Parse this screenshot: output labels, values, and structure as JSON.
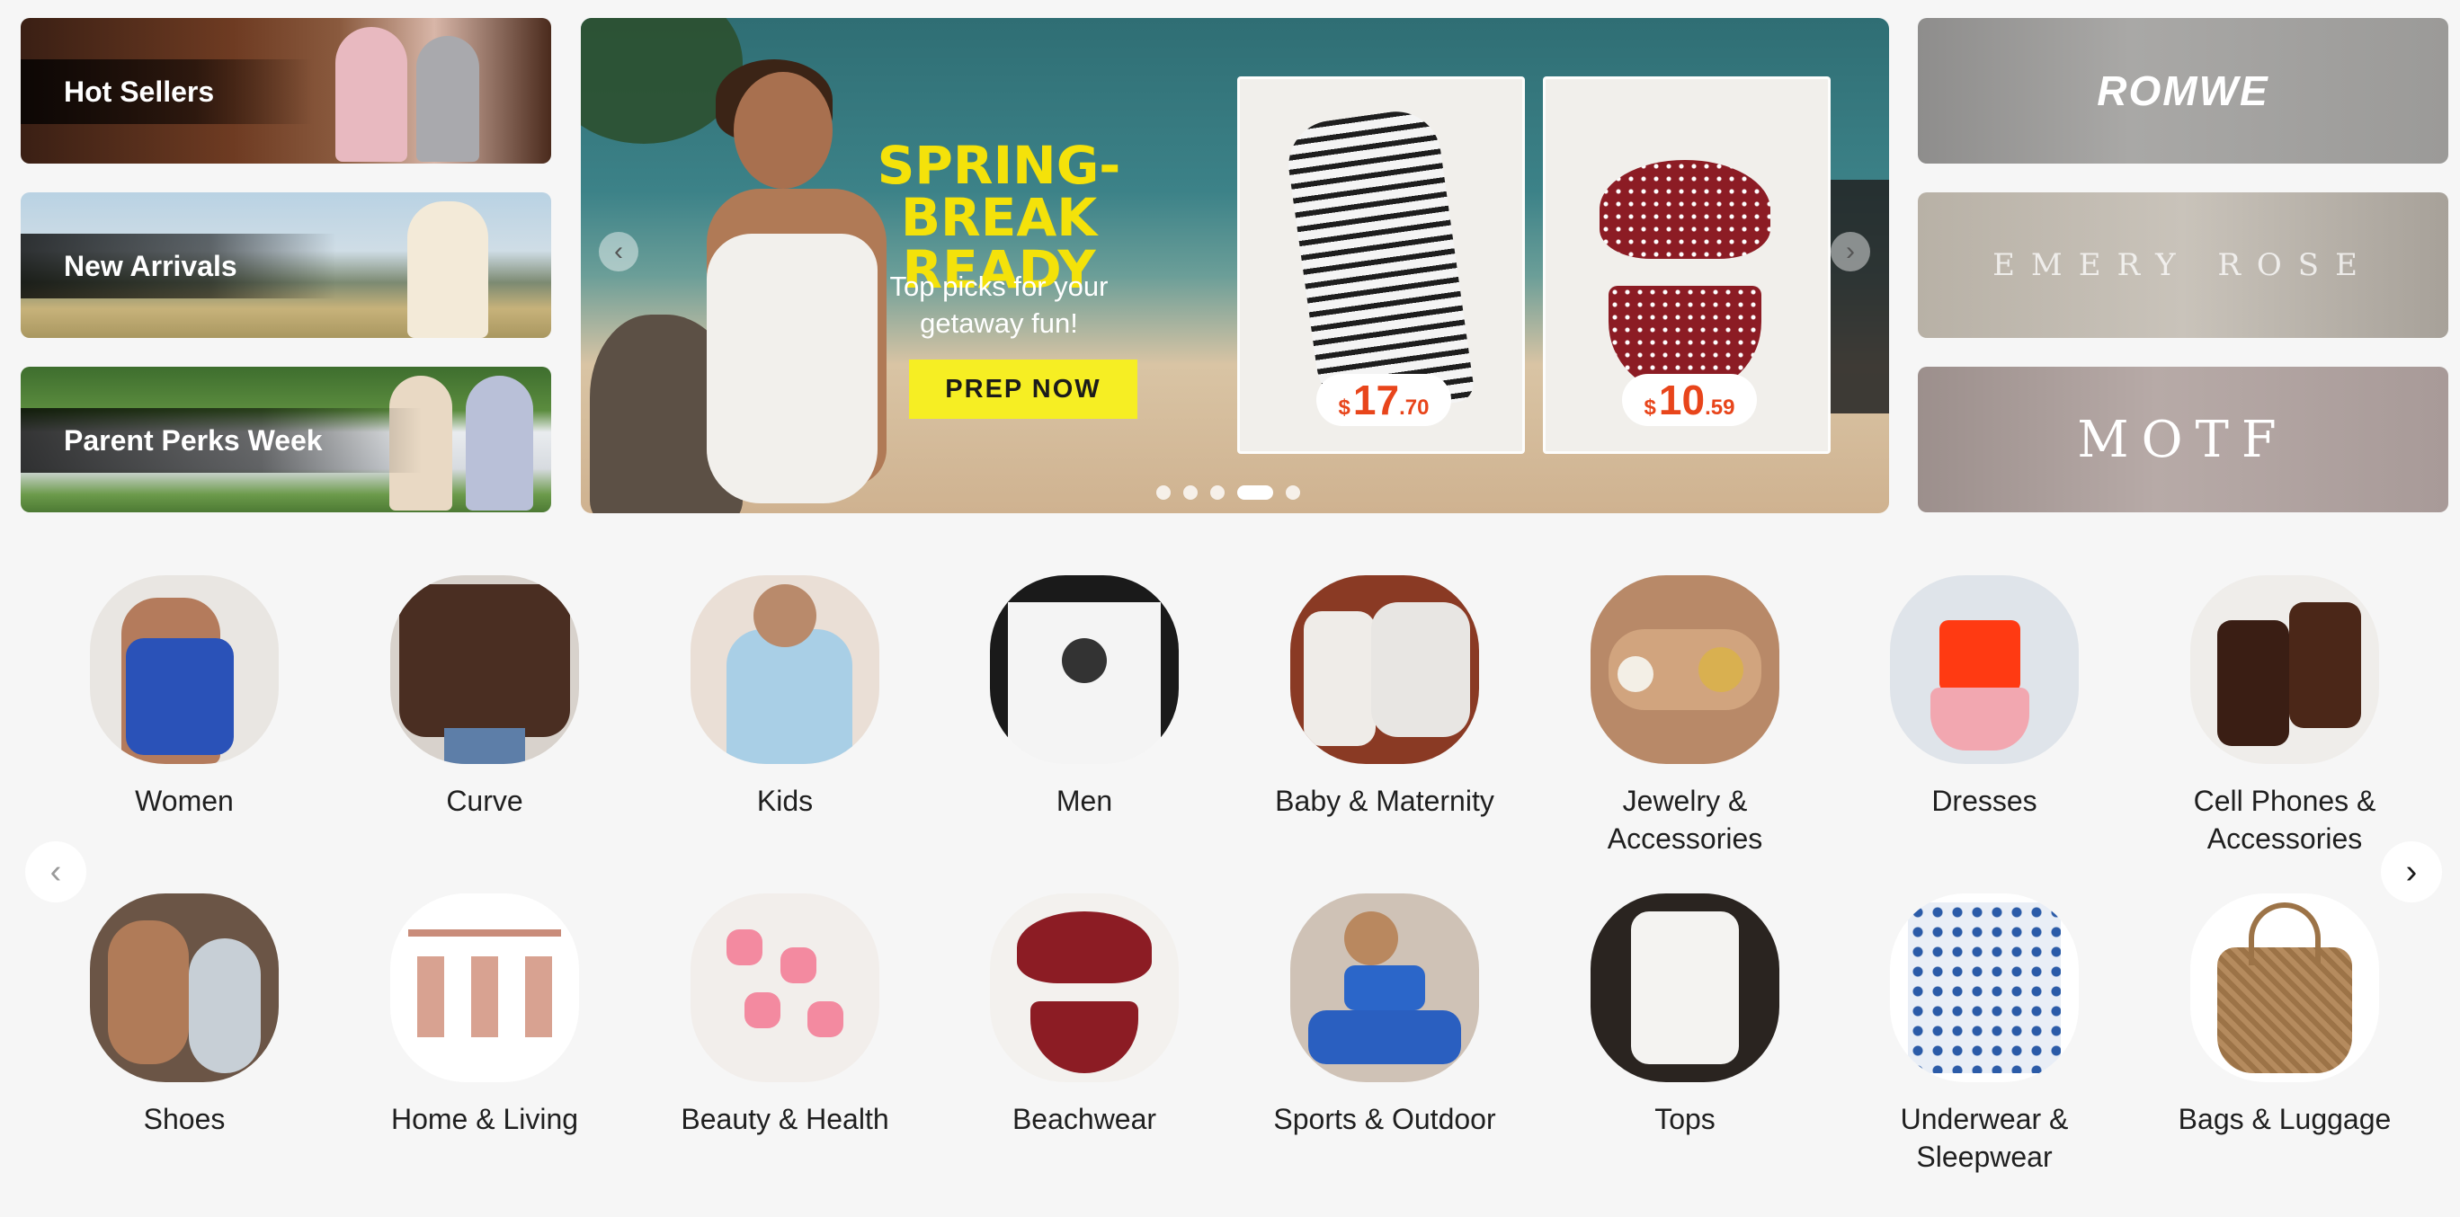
{
  "promos": [
    {
      "label": "Hot Sellers"
    },
    {
      "label": "New Arrivals"
    },
    {
      "label": "Parent Perks Week"
    }
  ],
  "banner": {
    "headline_line1": "SPRING-BREAK",
    "headline_line2": "READY",
    "subtext_line1": "Top picks for your",
    "subtext_line2": "getaway fun!",
    "cta": "PREP NOW",
    "products": [
      {
        "currency": "$",
        "price_main": "17",
        "price_cents": ".70"
      },
      {
        "currency": "$",
        "price_main": "10",
        "price_cents": ".59"
      }
    ],
    "prev_icon": "chevron-left-icon",
    "next_icon": "chevron-right-icon",
    "slide_count": 5,
    "active_slide": 4
  },
  "brands": [
    {
      "name": "ROMWE"
    },
    {
      "name": "EMERY ROSE"
    },
    {
      "name": "MOTF"
    }
  ],
  "categories": {
    "row1": [
      {
        "label": "Women"
      },
      {
        "label": "Curve"
      },
      {
        "label": "Kids"
      },
      {
        "label": "Men"
      },
      {
        "label": "Baby & Maternity"
      },
      {
        "label": "Jewelry & Accessories"
      },
      {
        "label": "Dresses"
      },
      {
        "label": "Cell Phones & Accessories"
      }
    ],
    "row2": [
      {
        "label": "Shoes"
      },
      {
        "label": "Home & Living"
      },
      {
        "label": "Beauty & Health"
      },
      {
        "label": "Beachwear"
      },
      {
        "label": "Sports & Outdoor"
      },
      {
        "label": "Tops"
      },
      {
        "label": "Underwear & Sleepwear"
      },
      {
        "label": "Bags & Luggage"
      }
    ],
    "prev_arrow": "‹",
    "next_arrow": "›"
  },
  "colors": {
    "cta_yellow": "#f6ee23",
    "headline_yellow": "#f4e20a",
    "price_red": "#e8451b",
    "page_bg": "#f6f6f6"
  }
}
